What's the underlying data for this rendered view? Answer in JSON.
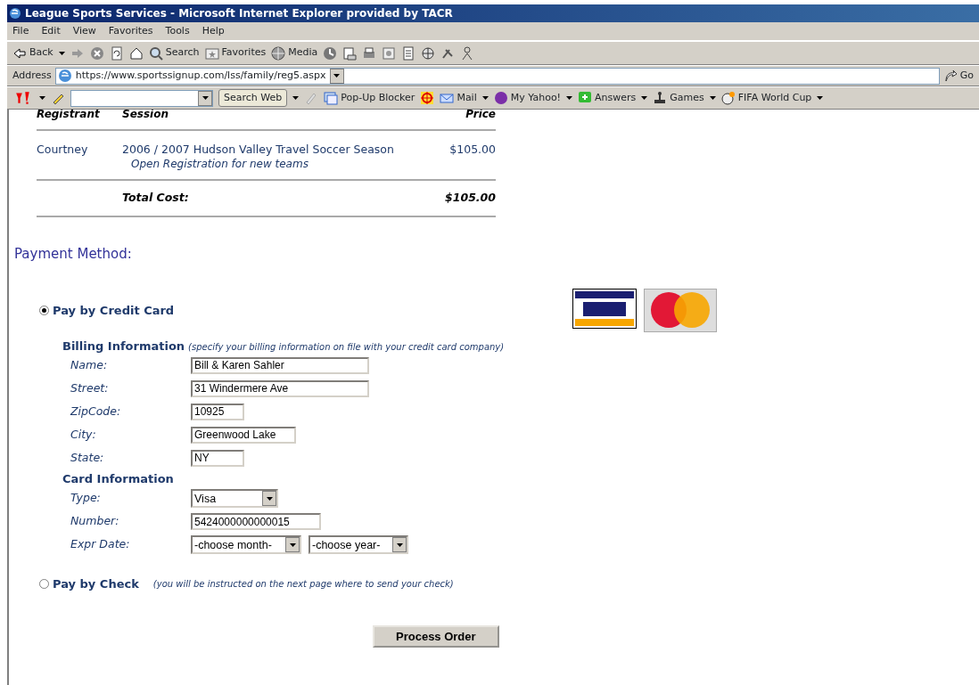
{
  "window": {
    "title": "League Sports Services - Microsoft Internet Explorer provided by TACR"
  },
  "menu": [
    "File",
    "Edit",
    "View",
    "Favorites",
    "Tools",
    "Help"
  ],
  "toolbar": {
    "back": "Back",
    "search": "Search",
    "favorites": "Favorites",
    "media": "Media"
  },
  "address": {
    "label": "Address",
    "url": "https://www.sportssignup.com/lss/family/reg5.aspx",
    "go": "Go"
  },
  "yahoo_toolbar": {
    "search_button": "Search Web",
    "popup": "Pop-Up Blocker",
    "items": [
      "Mail",
      "My Yahoo!",
      "Answers",
      "Games",
      "FIFA World Cup"
    ]
  },
  "order_table": {
    "columns": [
      "Registrant",
      "Session",
      "Price"
    ],
    "rows": [
      {
        "registrant": "Courtney",
        "session": "2006 / 2007 Hudson Valley Travel Soccer Season",
        "note": "Open Registration for new teams",
        "price": "$105.00"
      }
    ],
    "total_label": "Total Cost:",
    "total": "$105.00"
  },
  "payment": {
    "heading": "Payment Method:",
    "options": [
      {
        "label": "Pay by Credit Card",
        "selected": true
      },
      {
        "label": "Pay by Check",
        "note": "(you will be instructed on the next page where to send your check)",
        "selected": false
      }
    ],
    "billing": {
      "heading": "Billing Information",
      "note": "(specify your billing information on file with your credit card company)",
      "fields": [
        {
          "label": "Name:",
          "value": "Bill & Karen Sahler",
          "kind": "long"
        },
        {
          "label": "Street:",
          "value": "31 Windermere Ave",
          "kind": "long"
        },
        {
          "label": "ZipCode:",
          "value": "10925",
          "kind": "short"
        },
        {
          "label": "City:",
          "value": "Greenwood Lake",
          "kind": "medium"
        },
        {
          "label": "State:",
          "value": "NY",
          "kind": "short"
        }
      ]
    },
    "card": {
      "heading": "Card Information",
      "type_label": "Type:",
      "type": "Visa",
      "number_label": "Number:",
      "number": "5424000000000015",
      "expr_label": "Expr Date:",
      "month": "-choose month-",
      "year": "-choose year-"
    },
    "submit": "Process Order"
  }
}
